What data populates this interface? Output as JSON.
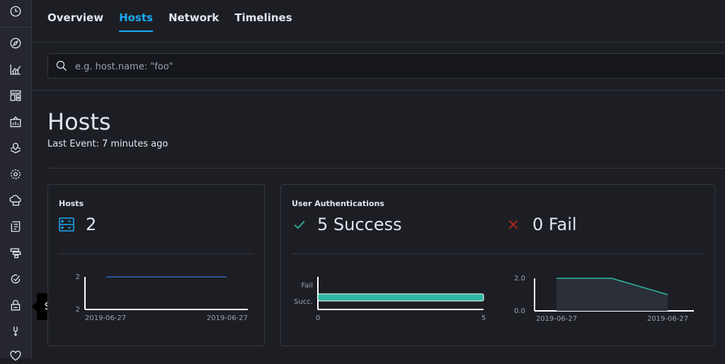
{
  "sidebar": {
    "items": [
      {
        "icon": "clock-icon"
      },
      {
        "icon": "compass-icon"
      },
      {
        "icon": "visualize-icon"
      },
      {
        "icon": "dashboard-icon"
      },
      {
        "icon": "canvas-icon"
      },
      {
        "icon": "maps-icon"
      },
      {
        "icon": "ml-icon"
      },
      {
        "icon": "infrastructure-icon"
      },
      {
        "icon": "logs-icon"
      },
      {
        "icon": "apm-icon"
      },
      {
        "icon": "uptime-icon"
      },
      {
        "icon": "siem-icon"
      },
      {
        "icon": "devtools-icon"
      },
      {
        "icon": "monitoring-icon"
      }
    ],
    "tooltip": "SIEM"
  },
  "tabs": [
    {
      "label": "Overview",
      "active": false
    },
    {
      "label": "Hosts",
      "active": true
    },
    {
      "label": "Network",
      "active": false
    },
    {
      "label": "Timelines",
      "active": false
    }
  ],
  "search": {
    "placeholder": "e.g. host.name: \"foo\""
  },
  "page": {
    "title": "Hosts",
    "last_event": "Last Event: 7 minutes ago"
  },
  "hosts_panel": {
    "title": "Hosts",
    "count": "2",
    "chart_data": {
      "type": "line",
      "x": [
        "2019-06-27",
        "2019-06-27"
      ],
      "series": [
        {
          "values": [
            2,
            2
          ]
        }
      ],
      "ytick": "2",
      "xlabels": [
        "2019-06-27",
        "2019-06-27"
      ],
      "color": "#2f5fbf"
    }
  },
  "auth_panel": {
    "title": "User Authentications",
    "success": "5 Success",
    "fail": "0 Fail",
    "bar_chart": {
      "type": "bar",
      "categories": [
        "Fail",
        "Succ."
      ],
      "values": [
        0,
        5
      ],
      "xlim": [
        0,
        5
      ],
      "xticks": [
        "0",
        "5"
      ],
      "color": "#2eb8a3"
    },
    "area_chart": {
      "type": "area",
      "yticks": [
        "2.0",
        "0.0"
      ],
      "xlabels": [
        "2019-06-27",
        "2019-06-27"
      ],
      "values": [
        2,
        2,
        1
      ],
      "color": "#2eb8a3"
    }
  },
  "colors": {
    "accent": "#1ba9f5",
    "success": "#2eb8a3",
    "fail": "#bd271e"
  }
}
